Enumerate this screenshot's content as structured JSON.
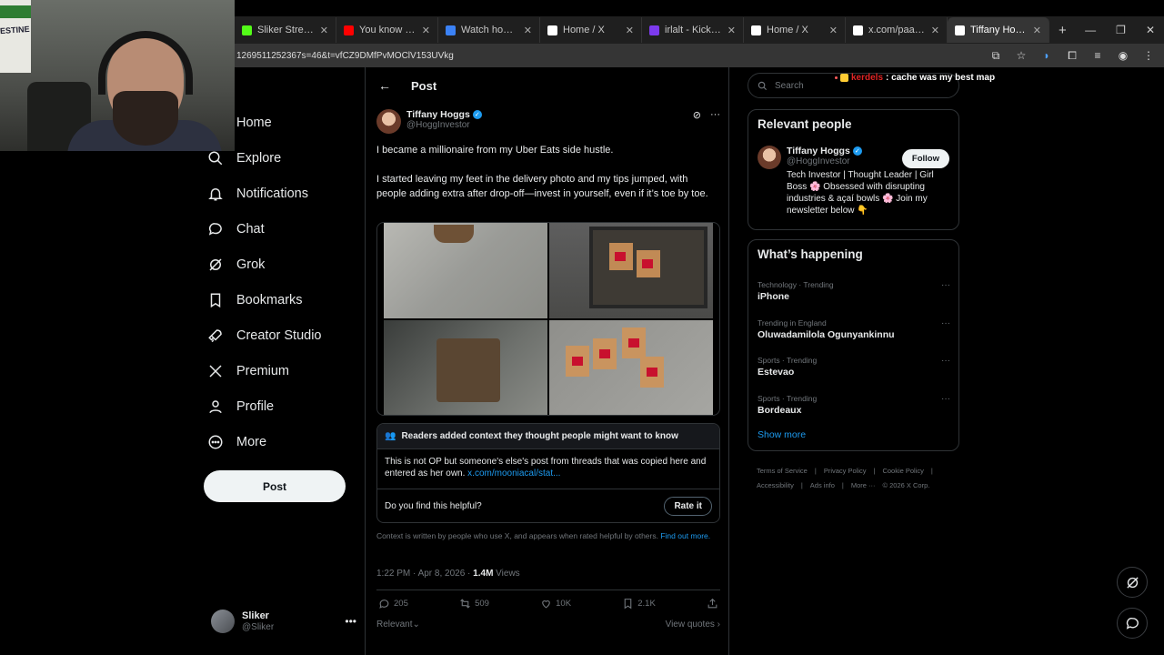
{
  "browser": {
    "tabs": [
      {
        "title": "Sliker Stream - W",
        "icon_color": "#53fc18",
        "active": false
      },
      {
        "title": "You know they g",
        "icon_color": "#ff0000",
        "active": false
      },
      {
        "title": "Watch homagaa",
        "icon_color": "#3b82f6",
        "active": false
      },
      {
        "title": "Home / X",
        "icon_color": "#ffffff",
        "active": false
      },
      {
        "title": "irlalt - Kick Stats, ",
        "icon_color": "#7c3aed",
        "active": false
      },
      {
        "title": "Home / X",
        "icon_color": "#ffffff",
        "active": false
      },
      {
        "title": "x.com/paaiinnnn/",
        "icon_color": "#ffffff",
        "active": false
      },
      {
        "title": "Tiffany Hoggs on",
        "icon_color": "#ffffff",
        "active": true
      }
    ],
    "url": "1269511252367s=46&t=vfCZ9DMfPvMOClV153UVkg"
  },
  "webcam": {
    "poster_text": "ESTINE"
  },
  "nav": {
    "items": [
      {
        "label": "Home",
        "icon": "home-icon"
      },
      {
        "label": "Explore",
        "icon": "search-icon"
      },
      {
        "label": "Notifications",
        "icon": "bell-icon"
      },
      {
        "label": "Chat",
        "icon": "chat-icon"
      },
      {
        "label": "Grok",
        "icon": "grok-icon"
      },
      {
        "label": "Bookmarks",
        "icon": "bookmark-icon"
      },
      {
        "label": "Creator Studio",
        "icon": "rocket-icon"
      },
      {
        "label": "Premium",
        "icon": "x-logo-icon"
      },
      {
        "label": "Profile",
        "icon": "person-icon"
      },
      {
        "label": "More",
        "icon": "more-circle-icon"
      }
    ],
    "post_button": "Post",
    "account": {
      "name": "Sliker",
      "handle": "@Sliker"
    }
  },
  "post": {
    "header_title": "Post",
    "author_name": "Tiffany Hoggs",
    "author_handle": "@HoggInvestor",
    "paragraph1": "I became a millionaire from my Uber Eats side hustle.",
    "paragraph2": "I started leaving my feet in the delivery photo and my tips jumped, with people adding extra after drop-off—invest in yourself, even if it’s toe by toe.",
    "note": {
      "header": "Readers added context they thought people might want to know",
      "body": "This is not OP but someone's else's post from threads that was copied here and entered as her own.",
      "link": "x.com/mooniacal/stat...",
      "question": "Do you find this helpful?",
      "rate_button": "Rate it"
    },
    "context_text": "Context is written by people who use X, and appears when rated helpful by others.",
    "context_link": "Find out more.",
    "timestamp": "1:22 PM · Apr 8, 2026 · ",
    "views_count": "1.4M",
    "views_label": " Views",
    "stats": {
      "replies": "205",
      "reposts": "509",
      "likes": "10K",
      "bookmarks": "2.1K"
    },
    "sort_label": "Relevant",
    "view_quotes": "View quotes"
  },
  "right": {
    "search_placeholder": "Search",
    "chat_overlay": {
      "user": "kerdels",
      "message": ": cache was my best map"
    },
    "relevant": {
      "title": "Relevant people",
      "name": "Tiffany Hoggs",
      "handle": "@HoggInvestor",
      "bio": "Tech Investor | Thought Leader | Girl Boss 🌸 Obsessed with disrupting industries & açaí bowls 🌸 Join my newsletter below 👇",
      "follow": "Follow"
    },
    "happening": {
      "title": "What’s happening",
      "trends": [
        {
          "category": "Technology · Trending",
          "name": "iPhone"
        },
        {
          "category": "Trending in England",
          "name": "Oluwadamilola Ogunyankinnu"
        },
        {
          "category": "Sports · Trending",
          "name": "Estevao"
        },
        {
          "category": "Sports · Trending",
          "name": "Bordeaux"
        }
      ],
      "show_more": "Show more"
    },
    "footer": {
      "line1": [
        "Terms of Service",
        "|",
        "Privacy Policy",
        "|",
        "Cookie Policy",
        "|"
      ],
      "line2": [
        "Accessibility",
        "|",
        "Ads info",
        "|",
        "More ···",
        "© 2026 X Corp."
      ]
    }
  }
}
